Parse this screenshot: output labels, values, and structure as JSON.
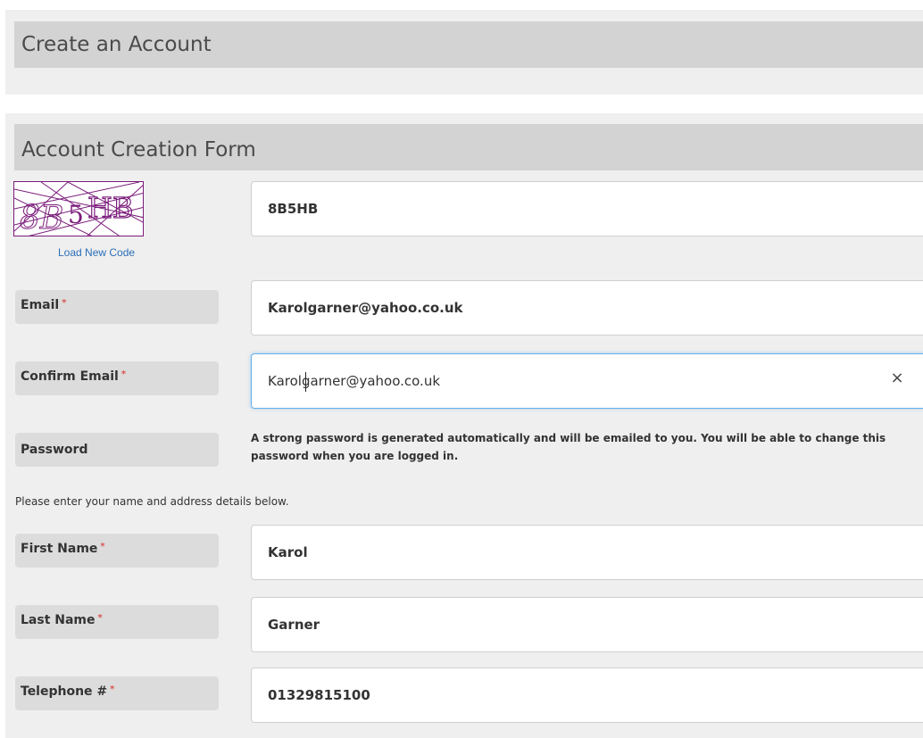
{
  "header": {
    "title": "Create an Account"
  },
  "form": {
    "title": "Account Creation Form",
    "captcha": {
      "code_text": "8B5HB",
      "value": "8B5HB",
      "load_new_code": "Load New Code"
    },
    "email": {
      "label": "Email",
      "required_mark": "*",
      "value": "Karolgarner@yahoo.co.uk"
    },
    "confirm_email": {
      "label": "Confirm Email",
      "required_mark": "*",
      "value": "Karolgarner@yahoo.co.uk",
      "clear": "×"
    },
    "password": {
      "label": "Password",
      "note": "A strong password is generated automatically and will be emailed to you. You will be able to change this password when you are logged in."
    },
    "instruction": "Please enter your name and address details below.",
    "first_name": {
      "label": "First Name",
      "required_mark": "*",
      "value": "Karol"
    },
    "last_name": {
      "label": "Last Name",
      "required_mark": "*",
      "value": "Garner"
    },
    "telephone": {
      "label": "Telephone #",
      "required_mark": "*",
      "value": "01329815100"
    }
  },
  "colors": {
    "panel_bg": "#efefef",
    "header_bg": "#d3d3d3",
    "label_bg": "#dcdcdc",
    "link": "#2a6fb8",
    "required": "#d9534f",
    "focus_border": "#66afe9",
    "captcha_ink": "#7b1c7b"
  }
}
